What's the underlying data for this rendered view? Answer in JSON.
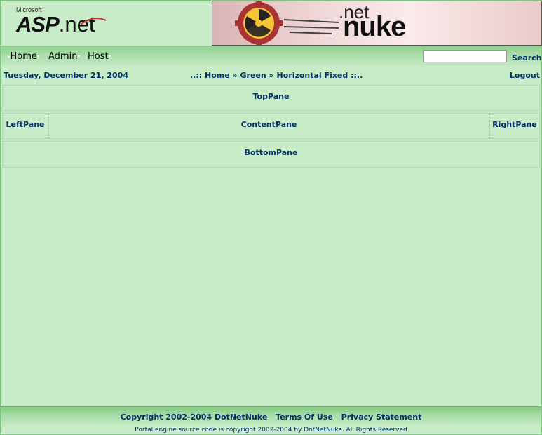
{
  "header": {
    "logo_small": "Microsoft",
    "logo_asp": "ASP",
    "logo_net": ".net",
    "banner_net": ".net",
    "banner_nuke": "nuke"
  },
  "menu": {
    "items": [
      {
        "label": "Home"
      },
      {
        "label": "Admin"
      },
      {
        "label": "Host"
      }
    ],
    "search_value": "",
    "search_label": "Search"
  },
  "info": {
    "date": "Tuesday, December 21, 2004",
    "breadcrumb_prefix": "..::",
    "breadcrumb": [
      "Home",
      "Green",
      "Horizontal Fixed"
    ],
    "breadcrumb_sep": "»",
    "breadcrumb_suffix": "::..",
    "logout": "Logout"
  },
  "panes": {
    "top": "TopPane",
    "left": "LeftPane",
    "content": "ContentPane",
    "right": "RightPane",
    "bottom": "BottomPane"
  },
  "footer": {
    "copyright": "Copyright 2002-2004 DotNetNuke",
    "terms": "Terms Of Use",
    "privacy": "Privacy Statement",
    "note": "Portal engine source code is copyright 2002-2004 by DotNetNuke. All Rights Reserved"
  },
  "colors": {
    "background": "#c8ecc8",
    "link": "#003366",
    "menubar": "#8fd08f"
  }
}
